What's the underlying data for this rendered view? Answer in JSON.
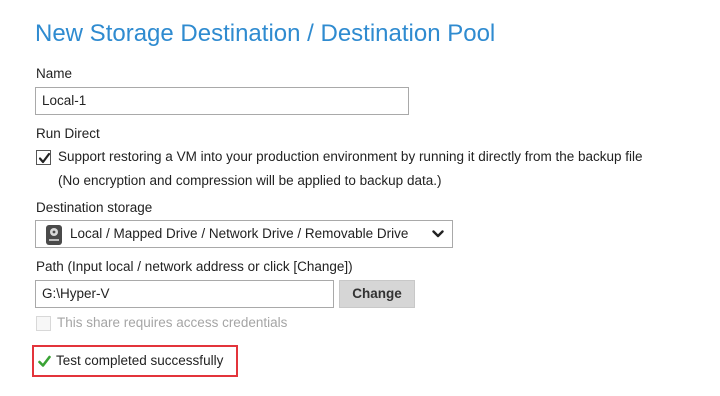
{
  "page_title": "New Storage Destination / Destination Pool",
  "name": {
    "label": "Name",
    "value": "Local-1"
  },
  "run_direct": {
    "label": "Run Direct",
    "checkbox_checked": true,
    "checkbox_text": "Support restoring a VM into your production environment by running it directly from the backup file",
    "note": "(No encryption and compression will be applied to backup data.)"
  },
  "destination_storage": {
    "label": "Destination storage",
    "selected": "Local / Mapped Drive / Network Drive / Removable Drive",
    "icon": "drive-icon"
  },
  "path": {
    "label": "Path (Input local / network address or click [Change])",
    "value": "G:\\Hyper-V",
    "change_label": "Change"
  },
  "credentials": {
    "checkbox_checked": false,
    "text": "This share requires access credentials",
    "disabled": true
  },
  "test_status": {
    "text": "Test completed successfully",
    "icon": "check-icon",
    "icon_color": "#3aa335",
    "highlight_color": "#e3343b"
  },
  "colors": {
    "accent": "#2f8bd0"
  }
}
